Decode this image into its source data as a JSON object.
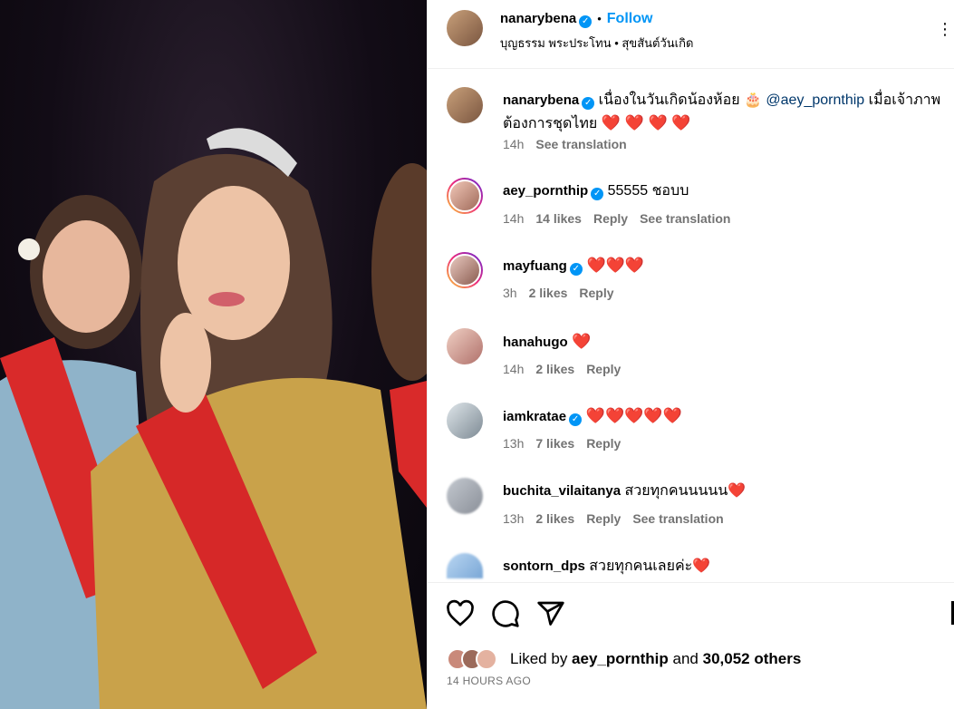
{
  "post": {
    "author": "nanarybena",
    "verified_mark": "✓",
    "dot": "•",
    "follow_label": "Follow",
    "audio_line": "บุญธรรม พระประโทน • สุขสันต์วันเกิด",
    "more_icon": "⋮"
  },
  "caption": {
    "username": "nanarybena",
    "text_before": " เนื่องในวันเกิดน้องห้อย 🎂 ",
    "mention": "@aey_pornthip",
    "text_after": " เมื่อเจ้าภาพต้องการชุดไทย ",
    "hearts": "❤️ ❤️ ❤️ ❤️",
    "time": "14h",
    "translate": "See translation"
  },
  "comments": [
    {
      "username": "aey_pornthip",
      "verified": true,
      "text": " 55555 ชอบบ",
      "time": "14h",
      "likes": "14 likes",
      "reply": "Reply",
      "translate": "See translation"
    },
    {
      "username": "mayfuang",
      "verified": true,
      "text": " ❤️❤️❤️",
      "time": "3h",
      "likes": "2 likes",
      "reply": "Reply",
      "translate": ""
    },
    {
      "username": "hanahugo",
      "verified": false,
      "text": " ❤️",
      "time": "14h",
      "likes": "2 likes",
      "reply": "Reply",
      "translate": ""
    },
    {
      "username": "iamkratae",
      "verified": true,
      "text": " ❤️❤️❤️❤️❤️",
      "time": "13h",
      "likes": "7 likes",
      "reply": "Reply",
      "translate": ""
    },
    {
      "username": "buchita_vilaitanya",
      "verified": false,
      "text": " สวยทุกคนนนนน❤️",
      "time": "13h",
      "likes": "2 likes",
      "reply": "Reply",
      "translate": "See translation"
    },
    {
      "username": "sontorn_dps",
      "verified": false,
      "text": " สวยทุกคนเลยค่ะ❤️",
      "time": "",
      "likes": "",
      "reply": "",
      "translate": ""
    }
  ],
  "footer": {
    "liked_prefix": "Liked by ",
    "liked_user": "aey_pornthip",
    "liked_mid": " and ",
    "liked_count": "30,052 others",
    "timestamp": "14 HOURS AGO"
  },
  "icons": {
    "like": "heart-icon",
    "comment": "comment-icon",
    "share": "share-icon",
    "save": "bookmark-icon"
  },
  "colors": {
    "accent": "#0095f6",
    "muted": "#737373",
    "sash": "#d62828",
    "gold": "#c9a24a"
  }
}
